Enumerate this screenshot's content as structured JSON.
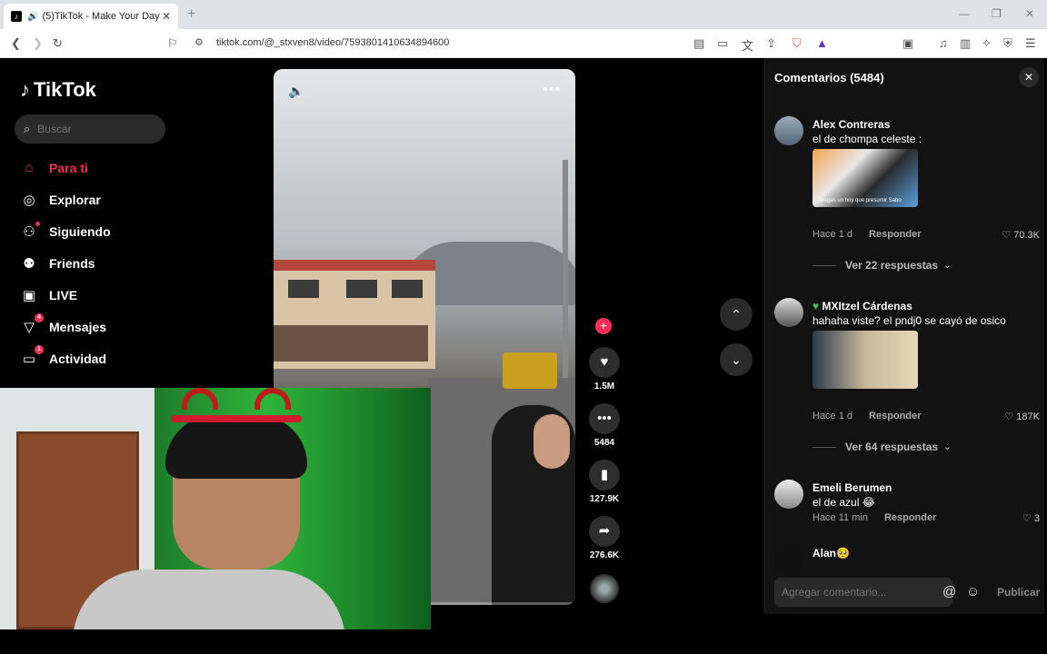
{
  "browser": {
    "tab_title": "(5)TikTok - Make Your Day",
    "url": "tiktok.com/@_stxven8/video/7593801410634894600"
  },
  "sidebar": {
    "logo": "TikTok",
    "search_placeholder": "Buscar",
    "items": [
      {
        "label": "Para ti",
        "icon": "home-icon",
        "active": true
      },
      {
        "label": "Explorar",
        "icon": "compass-icon"
      },
      {
        "label": "Siguiendo",
        "icon": "following-icon"
      },
      {
        "label": "Friends",
        "icon": "friends-icon"
      },
      {
        "label": "LIVE",
        "icon": "live-icon"
      },
      {
        "label": "Mensajes",
        "icon": "messages-icon",
        "badge": "4"
      },
      {
        "label": "Actividad",
        "icon": "activity-icon",
        "badge": "1"
      }
    ]
  },
  "video": {
    "progress_fraction": 0.08,
    "likes": "1.5M",
    "comments": "5484",
    "saves": "127.9K",
    "shares": "276.6K"
  },
  "comments_panel": {
    "title": "Comentarios",
    "count": "(5484)",
    "input_placeholder": "Agregar comentario...",
    "post_label": "Publicar",
    "items": [
      {
        "user": "Alex Contreras",
        "text": "el de chompa celeste :",
        "time": "Hace 1 d",
        "reply": "Responder",
        "likes": "70.3K",
        "view_replies": "Ver 22 respuestas",
        "image_caption": "Tengan un hoy que presumir Sabo"
      },
      {
        "user": "MXItzel Cárdenas",
        "text": "hahaha viste? el pndj0 se cayó de osico",
        "time": "Hace 1 d",
        "reply": "Responder",
        "likes": "187K",
        "view_replies": "Ver 64 respuestas"
      },
      {
        "user": "Emeli Berumen",
        "text": "el de azul 😂",
        "time": "Hace 11 min",
        "reply": "Responder",
        "likes": "3"
      },
      {
        "user": "Alan🥺",
        "text": ""
      }
    ]
  }
}
